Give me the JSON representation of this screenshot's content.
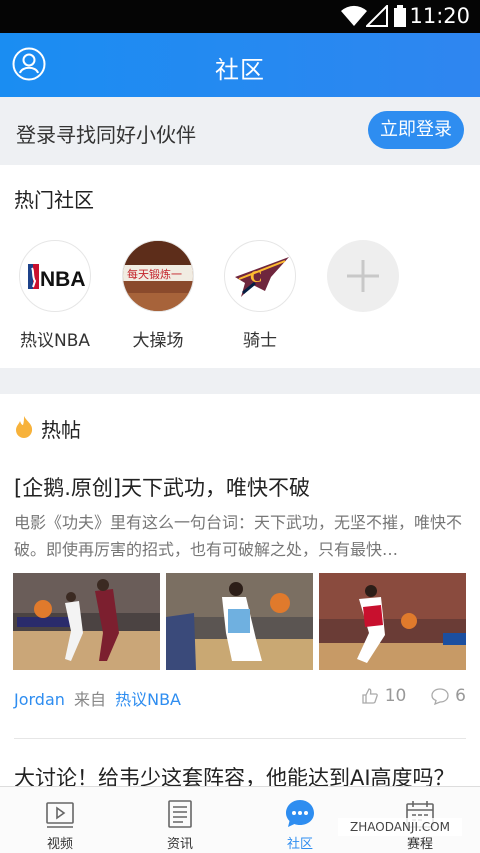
{
  "status_bar": {
    "time": "11:20"
  },
  "header": {
    "title": "社区"
  },
  "login_prompt": {
    "text": "登录寻找同好小伙伴",
    "button": "立即登录"
  },
  "hot_communities": {
    "title": "热门社区",
    "items": [
      {
        "name": "热议NBA",
        "icon": "nba-logo"
      },
      {
        "name": "大操场",
        "icon": "banner-photo"
      },
      {
        "name": "骑士",
        "icon": "cavaliers-logo"
      }
    ],
    "add_icon": "plus-icon"
  },
  "hot_posts": {
    "title": "热帖",
    "posts": [
      {
        "title": "[企鹅.原创]天下武功，唯快不破",
        "excerpt": "电影《功夫》里有这么一句台词：天下武功，无坚不摧，唯快不破。即使再厉害的招式，也有可破解之处，只有最快…",
        "author": "Jordan",
        "from_label": "来自",
        "community": "热议NBA",
        "likes": "10",
        "comments": "6"
      }
    ],
    "next_title": "大讨论！给韦少这套阵容，他能达到AI高度吗？"
  },
  "tabbar": {
    "items": [
      {
        "label": "视频",
        "icon": "video-icon"
      },
      {
        "label": "资讯",
        "icon": "news-icon"
      },
      {
        "label": "社区",
        "icon": "community-icon"
      },
      {
        "label": "赛程",
        "icon": "calendar-icon"
      }
    ],
    "active_index": 2
  },
  "watermark": "ZHAODANJI.COM",
  "colors": {
    "accent": "#2e8df0",
    "header": "#1a8df2"
  }
}
